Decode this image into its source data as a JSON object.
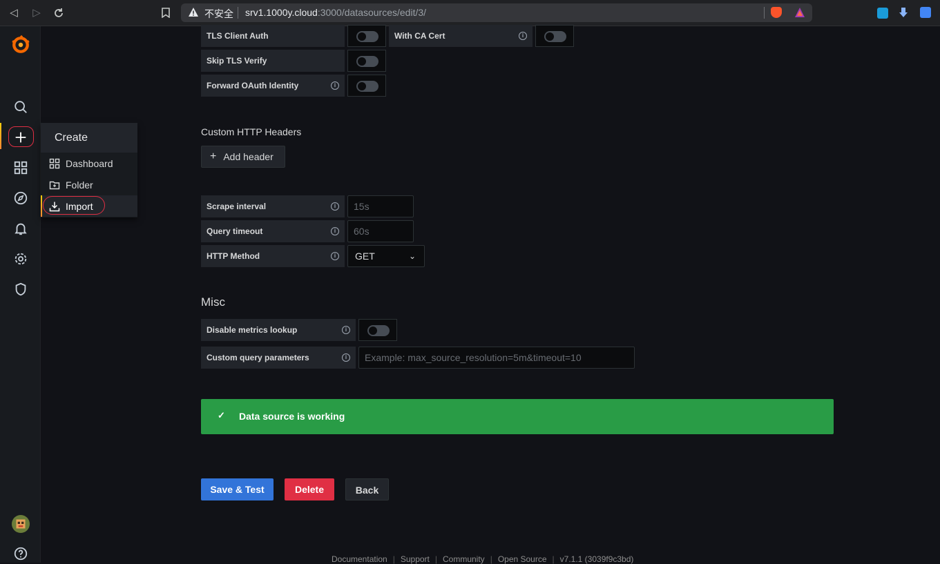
{
  "browser": {
    "insecure_label": "不安全",
    "url_host": "srv1.1000y.cloud",
    "url_path": ":3000/datasources/edit/3/"
  },
  "create_menu": {
    "header": "Create",
    "items": [
      {
        "label": "Dashboard",
        "icon": "apps-icon"
      },
      {
        "label": "Folder",
        "icon": "folder-plus-icon"
      },
      {
        "label": "Import",
        "icon": "import-icon"
      }
    ]
  },
  "auth": {
    "tls_client_auth": "TLS Client Auth",
    "with_ca_cert": "With CA Cert",
    "skip_tls_verify": "Skip TLS Verify",
    "forward_oauth": "Forward OAuth Identity"
  },
  "headers": {
    "title": "Custom HTTP Headers",
    "add_label": "Add header"
  },
  "settings": {
    "scrape_interval_label": "Scrape interval",
    "scrape_interval_placeholder": "15s",
    "query_timeout_label": "Query timeout",
    "query_timeout_placeholder": "60s",
    "http_method_label": "HTTP Method",
    "http_method_value": "GET"
  },
  "misc": {
    "title": "Misc",
    "disable_metrics_label": "Disable metrics lookup",
    "custom_query_label": "Custom query parameters",
    "custom_query_placeholder": "Example: max_source_resolution=5m&timeout=10"
  },
  "alert": {
    "message": "Data source is working"
  },
  "actions": {
    "save_label": "Save & Test",
    "delete_label": "Delete",
    "back_label": "Back"
  },
  "footer": {
    "documentation": "Documentation",
    "support": "Support",
    "community": "Community",
    "open_source": "Open Source",
    "version": "v7.1.1 (3039f9c3bd)"
  },
  "colors": {
    "primary": "#3274d9",
    "danger": "#e02f44",
    "success": "#299c46",
    "background": "#111217"
  }
}
